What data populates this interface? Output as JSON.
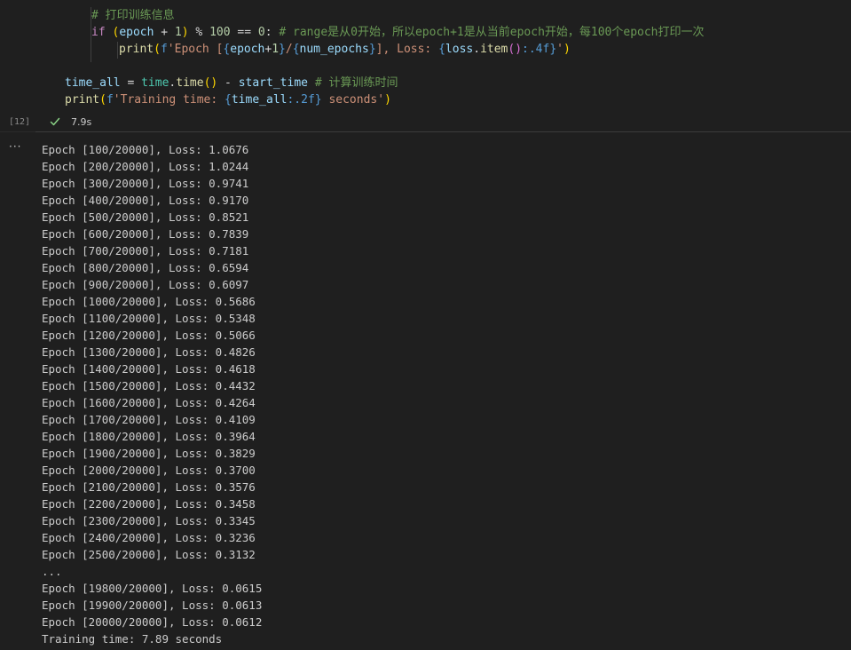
{
  "cell": {
    "execution_count": "[12]",
    "status_icon": "check-icon",
    "exec_time": "7.9s",
    "code_lines": [
      {
        "tokens": [
          {
            "t": "comment",
            "v": "# 打印训练信息"
          }
        ]
      },
      {
        "tokens": [
          {
            "t": "keyword",
            "v": "if"
          },
          {
            "t": "op",
            "v": " "
          },
          {
            "t": "paren1",
            "v": "("
          },
          {
            "t": "var",
            "v": "epoch"
          },
          {
            "t": "op",
            "v": " + "
          },
          {
            "t": "num",
            "v": "1"
          },
          {
            "t": "paren1",
            "v": ")"
          },
          {
            "t": "op",
            "v": " % "
          },
          {
            "t": "num",
            "v": "100"
          },
          {
            "t": "op",
            "v": " == "
          },
          {
            "t": "num",
            "v": "0"
          },
          {
            "t": "op",
            "v": ": "
          },
          {
            "t": "comment",
            "v": "# range是从0开始，所以epoch+1是从当前epoch开始，每100个epoch打印一次"
          }
        ]
      },
      {
        "tokens": [
          {
            "t": "func",
            "v": "print"
          },
          {
            "t": "paren1",
            "v": "("
          },
          {
            "t": "fmt",
            "v": "f"
          },
          {
            "t": "str",
            "v": "'Epoch ["
          },
          {
            "t": "fmt",
            "v": "{"
          },
          {
            "t": "var",
            "v": "epoch"
          },
          {
            "t": "op",
            "v": "+"
          },
          {
            "t": "num",
            "v": "1"
          },
          {
            "t": "fmt",
            "v": "}"
          },
          {
            "t": "str",
            "v": "/"
          },
          {
            "t": "fmt",
            "v": "{"
          },
          {
            "t": "var",
            "v": "num_epochs"
          },
          {
            "t": "fmt",
            "v": "}"
          },
          {
            "t": "str",
            "v": "], Loss: "
          },
          {
            "t": "fmt",
            "v": "{"
          },
          {
            "t": "var",
            "v": "loss"
          },
          {
            "t": "op",
            "v": "."
          },
          {
            "t": "func",
            "v": "item"
          },
          {
            "t": "paren2",
            "v": "()"
          },
          {
            "t": "fmt",
            "v": ":.4f}"
          },
          {
            "t": "str",
            "v": "'"
          },
          {
            "t": "paren1",
            "v": ")"
          }
        ]
      },
      {
        "tokens": [
          {
            "t": "var",
            "v": "time_all"
          },
          {
            "t": "op",
            "v": " = "
          },
          {
            "t": "module",
            "v": "time"
          },
          {
            "t": "op",
            "v": "."
          },
          {
            "t": "func",
            "v": "time"
          },
          {
            "t": "paren1",
            "v": "()"
          },
          {
            "t": "op",
            "v": " - "
          },
          {
            "t": "var",
            "v": "start_time"
          },
          {
            "t": "op",
            "v": " "
          },
          {
            "t": "comment",
            "v": "# 计算训练时间"
          }
        ]
      },
      {
        "tokens": [
          {
            "t": "func",
            "v": "print"
          },
          {
            "t": "paren1",
            "v": "("
          },
          {
            "t": "fmt",
            "v": "f"
          },
          {
            "t": "str",
            "v": "'Training time: "
          },
          {
            "t": "fmt",
            "v": "{"
          },
          {
            "t": "var",
            "v": "time_all"
          },
          {
            "t": "fmt",
            "v": ":.2f}"
          },
          {
            "t": "str",
            "v": " seconds'"
          },
          {
            "t": "paren1",
            "v": ")"
          }
        ]
      }
    ]
  },
  "output": {
    "menu_label": "···",
    "lines": [
      "Epoch [100/20000], Loss: 1.0676",
      "Epoch [200/20000], Loss: 1.0244",
      "Epoch [300/20000], Loss: 0.9741",
      "Epoch [400/20000], Loss: 0.9170",
      "Epoch [500/20000], Loss: 0.8521",
      "Epoch [600/20000], Loss: 0.7839",
      "Epoch [700/20000], Loss: 0.7181",
      "Epoch [800/20000], Loss: 0.6594",
      "Epoch [900/20000], Loss: 0.6097",
      "Epoch [1000/20000], Loss: 0.5686",
      "Epoch [1100/20000], Loss: 0.5348",
      "Epoch [1200/20000], Loss: 0.5066",
      "Epoch [1300/20000], Loss: 0.4826",
      "Epoch [1400/20000], Loss: 0.4618",
      "Epoch [1500/20000], Loss: 0.4432",
      "Epoch [1600/20000], Loss: 0.4264",
      "Epoch [1700/20000], Loss: 0.4109",
      "Epoch [1800/20000], Loss: 0.3964",
      "Epoch [1900/20000], Loss: 0.3829",
      "Epoch [2000/20000], Loss: 0.3700",
      "Epoch [2100/20000], Loss: 0.3576",
      "Epoch [2200/20000], Loss: 0.3458",
      "Epoch [2300/20000], Loss: 0.3345",
      "Epoch [2400/20000], Loss: 0.3236",
      "Epoch [2500/20000], Loss: 0.3132",
      "...",
      "Epoch [19800/20000], Loss: 0.0615",
      "Epoch [19900/20000], Loss: 0.0613",
      "Epoch [20000/20000], Loss: 0.0612",
      "Training time: 7.89 seconds"
    ]
  }
}
